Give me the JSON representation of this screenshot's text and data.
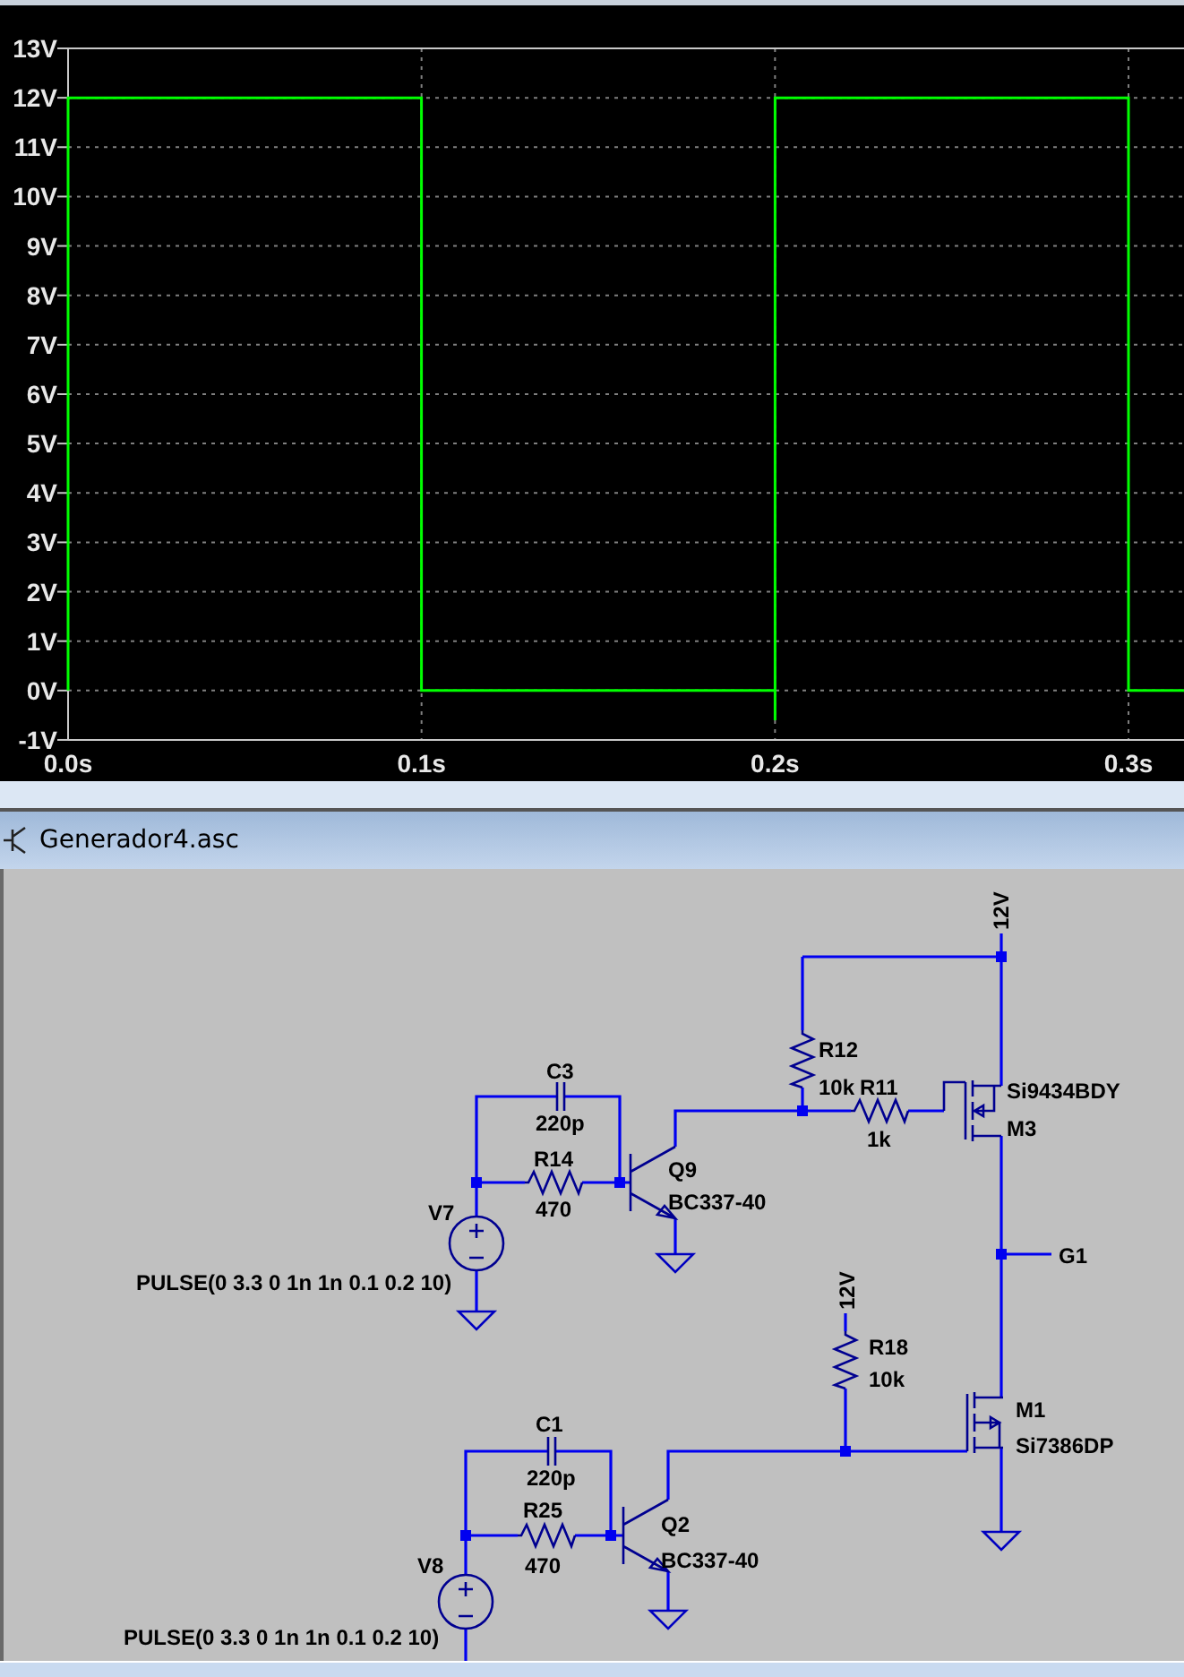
{
  "plot": {
    "chart_data": {
      "type": "line",
      "x": [
        0,
        0,
        0.1,
        0.1,
        0.2,
        0.2,
        0.2,
        0.3,
        0.3,
        0.3157
      ],
      "series": [
        {
          "color": "#00ff00",
          "values": [
            0,
            12,
            12,
            0,
            0,
            -0.6,
            12,
            12,
            0,
            0
          ]
        }
      ],
      "xlim": [
        0,
        0.3157
      ],
      "ylim": [
        -1,
        13
      ],
      "grid": true,
      "xticks": [
        {
          "value": 0,
          "label": "0.0s"
        },
        {
          "value": 0.1,
          "label": "0.1s"
        },
        {
          "value": 0.2,
          "label": "0.2s"
        },
        {
          "value": 0.3,
          "label": "0.3s"
        }
      ],
      "yticks": [
        {
          "value": 13,
          "label": "13V"
        },
        {
          "value": 12,
          "label": "12V"
        },
        {
          "value": 11,
          "label": "11V"
        },
        {
          "value": 10,
          "label": "10V"
        },
        {
          "value": 9,
          "label": "9V"
        },
        {
          "value": 8,
          "label": "8V"
        },
        {
          "value": 7,
          "label": "7V"
        },
        {
          "value": 6,
          "label": "6V"
        },
        {
          "value": 5,
          "label": "5V"
        },
        {
          "value": 4,
          "label": "4V"
        },
        {
          "value": 3,
          "label": "3V"
        },
        {
          "value": 2,
          "label": "2V"
        },
        {
          "value": 1,
          "label": "1V"
        },
        {
          "value": 0,
          "label": "0V"
        },
        {
          "value": -1,
          "label": "-1V"
        }
      ]
    }
  },
  "schematic": {
    "title": "Generador4.asc",
    "parts": [
      {
        "kind": "net",
        "label": "12V"
      },
      {
        "kind": "resistor",
        "ref": "R12",
        "value": "10k"
      },
      {
        "kind": "capacitor",
        "ref": "C3",
        "value": "220p"
      },
      {
        "kind": "resistor",
        "ref": "R11",
        "value": "1k"
      },
      {
        "kind": "pmos",
        "ref": "M3",
        "value": "Si9434BDY"
      },
      {
        "kind": "resistor",
        "ref": "R14",
        "value": "470"
      },
      {
        "kind": "npn",
        "ref": "Q9",
        "value": "BC337-40"
      },
      {
        "kind": "vsource",
        "ref": "V7",
        "value": "PULSE(0 3.3 0 1n 1n 0.1 0.2 10)"
      },
      {
        "kind": "net",
        "label": "G1"
      },
      {
        "kind": "net",
        "label": "12V"
      },
      {
        "kind": "resistor",
        "ref": "R18",
        "value": "10k"
      },
      {
        "kind": "nmos",
        "ref": "M1",
        "value": "Si7386DP"
      },
      {
        "kind": "capacitor",
        "ref": "C1",
        "value": "220p"
      },
      {
        "kind": "resistor",
        "ref": "R25",
        "value": "470"
      },
      {
        "kind": "npn",
        "ref": "Q2",
        "value": "BC337-40"
      },
      {
        "kind": "vsource",
        "ref": "V8",
        "value": "PULSE(0 3.3 0 1n 1n 0.1 0.2 10)"
      }
    ]
  }
}
